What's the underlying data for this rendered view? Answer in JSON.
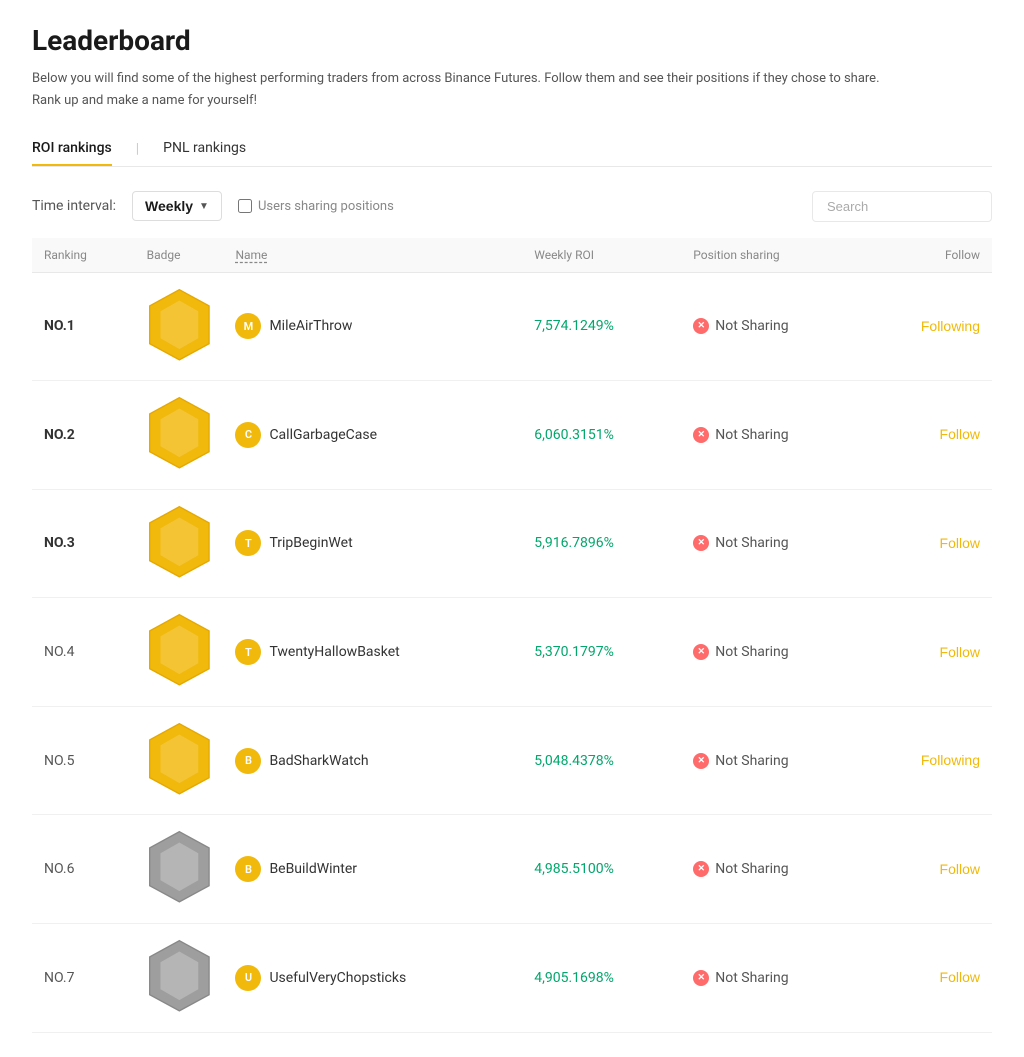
{
  "page": {
    "title": "Leaderboard",
    "subtitle1": "Below you will find some of the highest performing traders from across Binance Futures. Follow them and see their positions if they chose to share.",
    "subtitle2": "Rank up and make a name for yourself!"
  },
  "tabs": [
    {
      "id": "roi",
      "label": "ROI rankings",
      "active": true
    },
    {
      "id": "pnl",
      "label": "PNL rankings",
      "active": false
    }
  ],
  "controls": {
    "time_interval_label": "Time interval:",
    "dropdown_value": "Weekly",
    "checkbox_label": "Users sharing positions",
    "search_placeholder": "Search"
  },
  "table": {
    "headers": [
      {
        "id": "ranking",
        "label": "Ranking"
      },
      {
        "id": "badge",
        "label": "Badge"
      },
      {
        "id": "name",
        "label": "Name"
      },
      {
        "id": "weekly_roi",
        "label": "Weekly ROI"
      },
      {
        "id": "position_sharing",
        "label": "Position sharing"
      },
      {
        "id": "follow",
        "label": "Follow"
      }
    ],
    "rows": [
      {
        "rank": "NO.1",
        "bold": true,
        "badge_type": "gold",
        "name": "MileAirThrow",
        "roi": "7,574.1249%",
        "position_sharing": "Not Sharing",
        "follow": "Following",
        "follow_type": "following"
      },
      {
        "rank": "NO.2",
        "bold": true,
        "badge_type": "gold",
        "name": "CallGarbageCase",
        "roi": "6,060.3151%",
        "position_sharing": "Not Sharing",
        "follow": "Follow",
        "follow_type": "follow"
      },
      {
        "rank": "NO.3",
        "bold": true,
        "badge_type": "gold",
        "name": "TripBeginWet",
        "roi": "5,916.7896%",
        "position_sharing": "Not Sharing",
        "follow": "Follow",
        "follow_type": "follow"
      },
      {
        "rank": "NO.4",
        "bold": false,
        "badge_type": "gold",
        "name": "TwentyHallowBasket",
        "roi": "5,370.1797%",
        "position_sharing": "Not Sharing",
        "follow": "Follow",
        "follow_type": "follow"
      },
      {
        "rank": "NO.5",
        "bold": false,
        "badge_type": "gold",
        "name": "BadSharkWatch",
        "roi": "5,048.4378%",
        "position_sharing": "Not Sharing",
        "follow": "Following",
        "follow_type": "following"
      },
      {
        "rank": "NO.6",
        "bold": false,
        "badge_type": "silver",
        "name": "BeBuildWinter",
        "roi": "4,985.5100%",
        "position_sharing": "Not Sharing",
        "follow": "Follow",
        "follow_type": "follow"
      },
      {
        "rank": "NO.7",
        "bold": false,
        "badge_type": "silver",
        "name": "UsefulVeryChopsticks",
        "roi": "4,905.1698%",
        "position_sharing": "Not Sharing",
        "follow": "Follow",
        "follow_type": "follow"
      }
    ]
  }
}
